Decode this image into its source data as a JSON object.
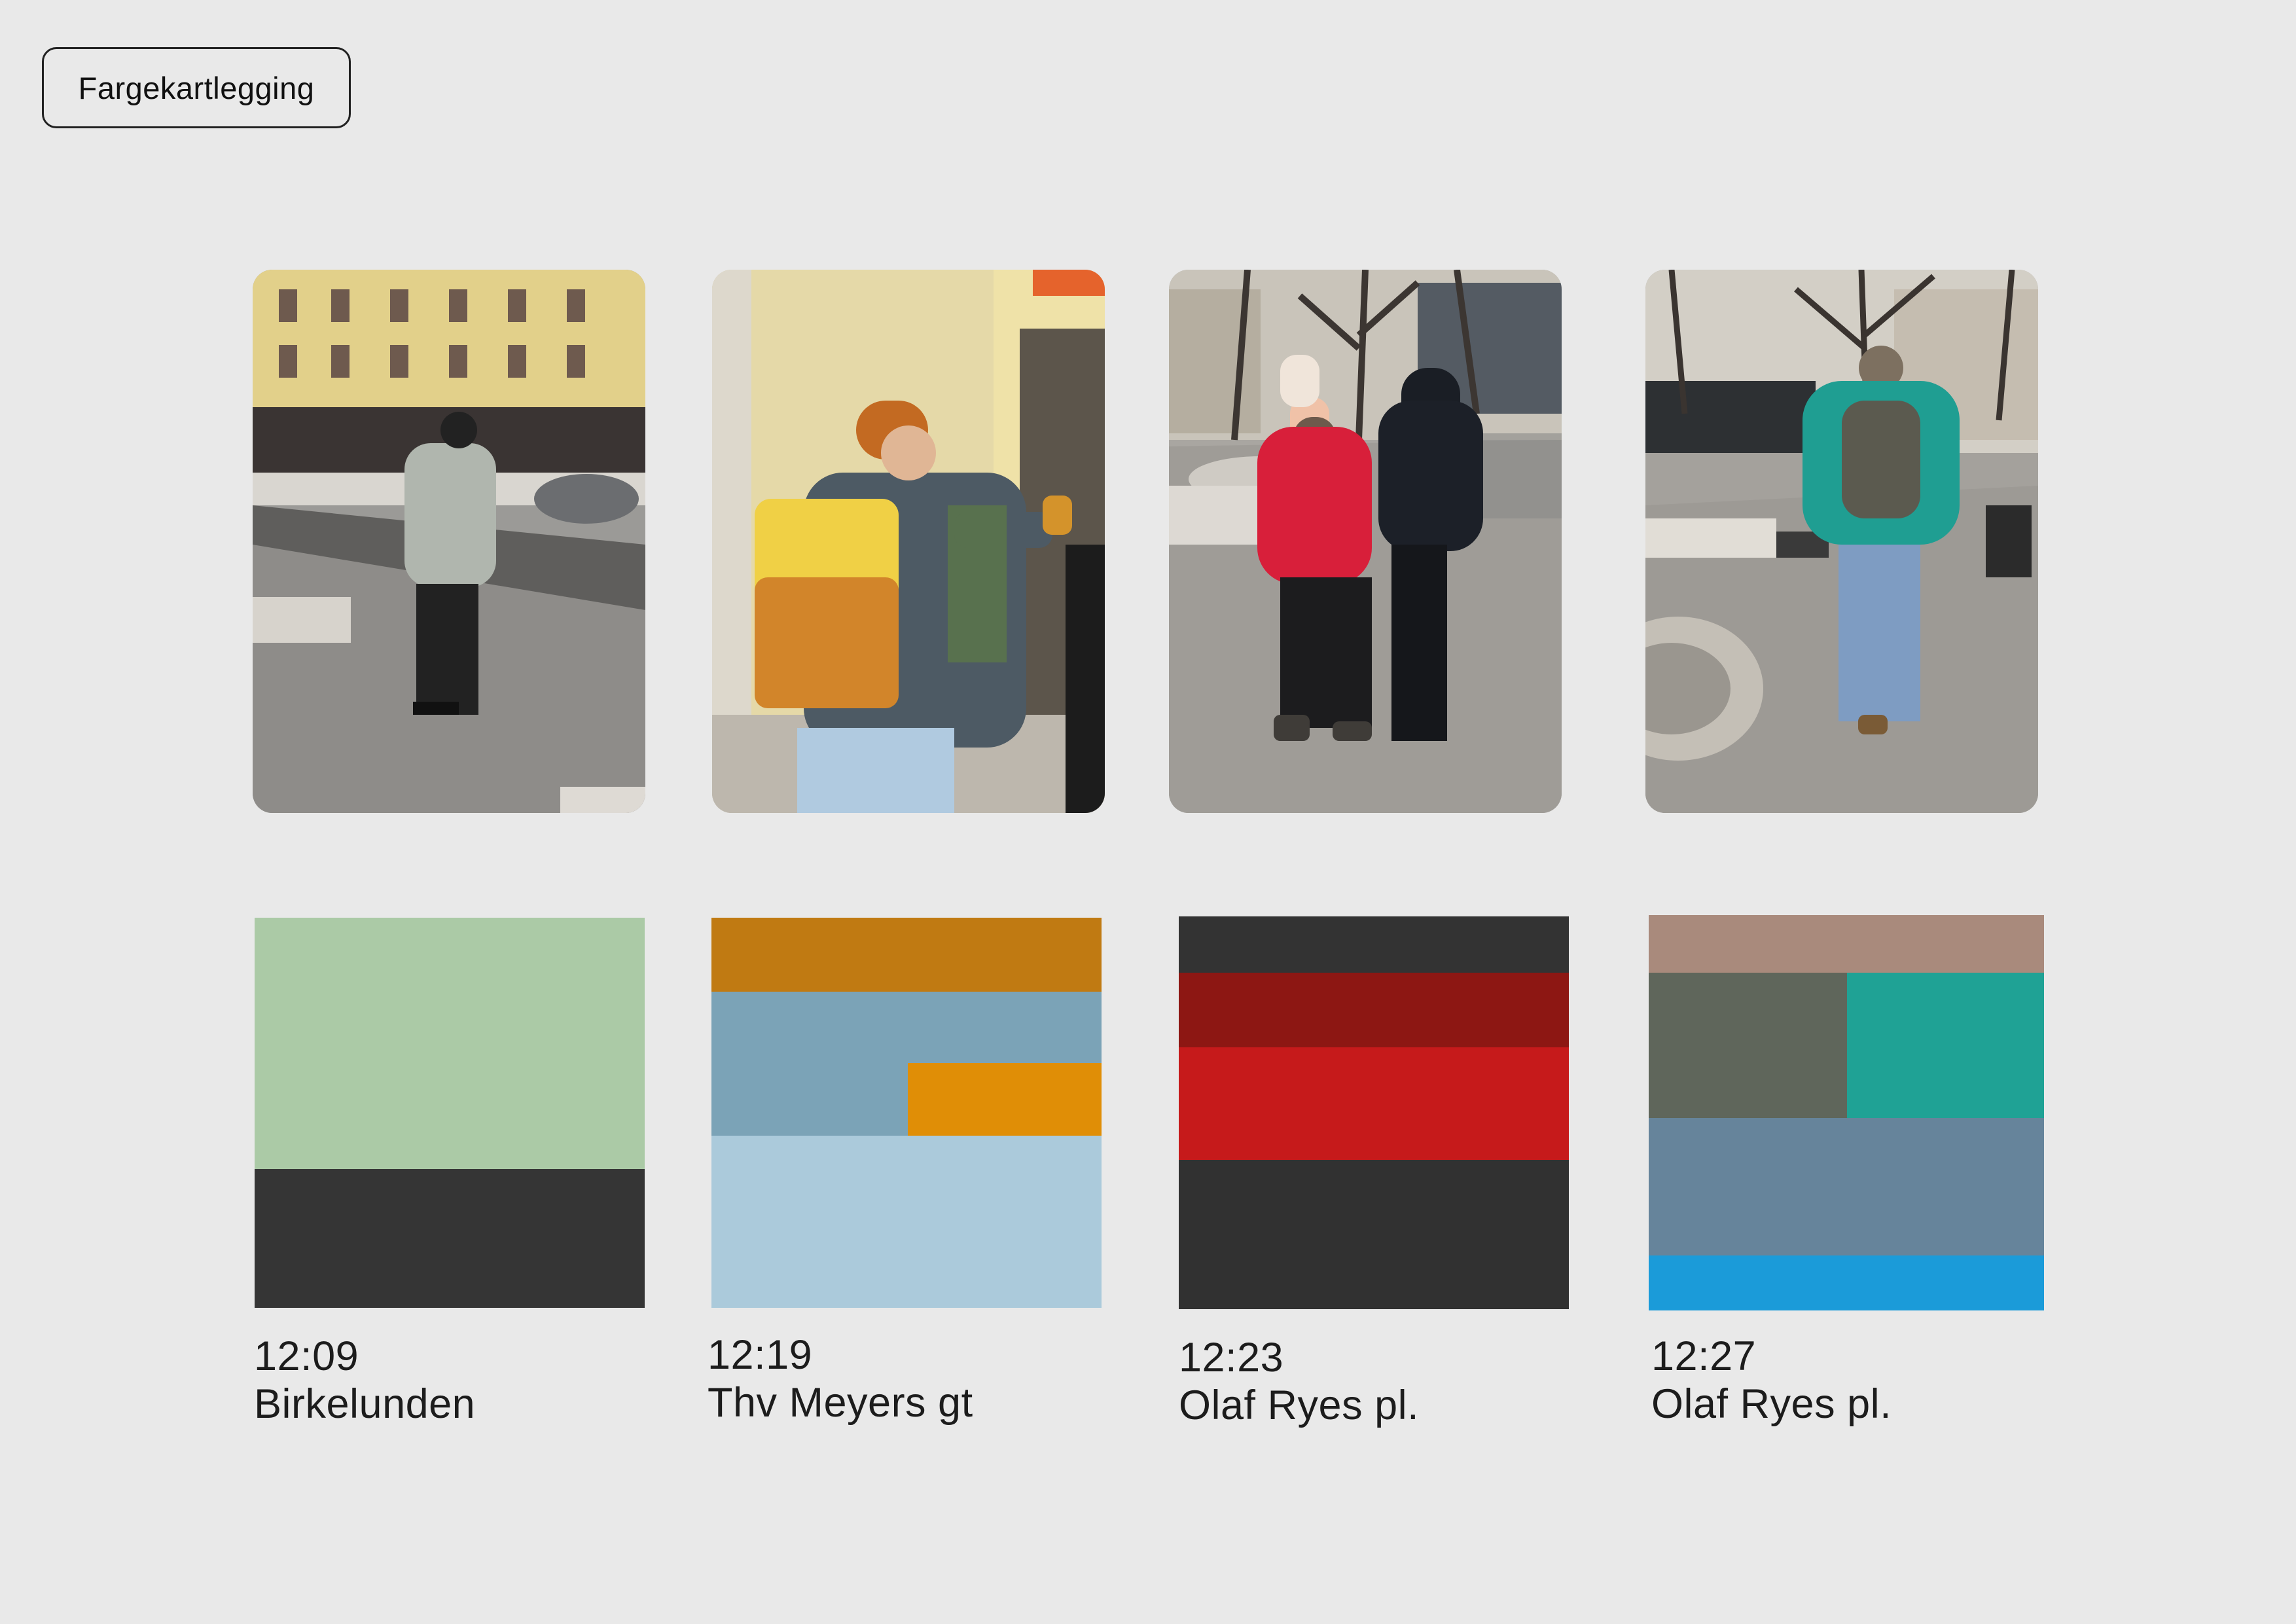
{
  "page": {
    "title": "Fargekartlegging",
    "background": "#e9e9e9"
  },
  "entries": [
    {
      "time": "12:09",
      "place": "Birkelunden",
      "photo_icon": "street-photo-grey-vest-icon",
      "colors": [
        "#abcaa6",
        "#353535"
      ]
    },
    {
      "time": "12:19",
      "place": "Thv Meyers gt",
      "photo_icon": "street-photo-yellow-backpack-icon",
      "colors": [
        "#c07a12",
        "#7ba3b7",
        "#e08e06",
        "#abcadb"
      ]
    },
    {
      "time": "12:23",
      "place": "Olaf Ryes pl.",
      "photo_icon": "street-photo-red-jacket-icon",
      "colors": [
        "#333333",
        "#8d1713",
        "#c61a1b",
        "#313131"
      ]
    },
    {
      "time": "12:27",
      "place": "Olaf Ryes pl.",
      "photo_icon": "street-photo-teal-jacket-icon",
      "colors": [
        "#a98a7c",
        "#5f665b",
        "#1fa295",
        "#66849b",
        "#1b9bd9"
      ]
    }
  ]
}
